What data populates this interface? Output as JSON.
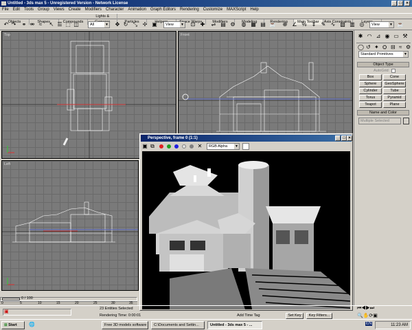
{
  "app": {
    "title": "Untitled - 3ds max 5 - Unregistered Version - Network License"
  },
  "menu": [
    "File",
    "Edit",
    "Tools",
    "Group",
    "Views",
    "Create",
    "Modifiers",
    "Character",
    "Animation",
    "Graph Editors",
    "Rendering",
    "Customize",
    "MAXScript",
    "Help"
  ],
  "tabs": [
    "Objects",
    "Shapes",
    "Compounds",
    "Lights & Cameras",
    "Particles",
    "Helpers",
    "Space Warps",
    "Modifiers",
    "Modeling",
    "Rendering",
    "Main Toolbar",
    "Axis Constraints",
    "Layers"
  ],
  "active_tab": "Main Toolbar",
  "toolbar": {
    "selection_filter": "All",
    "ref_coord": "View",
    "ref_coord2": "View"
  },
  "viewports": {
    "top": "Top",
    "front": "Front",
    "left": "Left",
    "perspective": "Perspective"
  },
  "command_panel": {
    "category": "Standard Primitives",
    "object_type_header": "Object Type",
    "autogrid": "AutoGrid",
    "buttons": [
      "Box",
      "Cone",
      "Sphere",
      "GeoSphere",
      "Cylinder",
      "Tube",
      "Torus",
      "Pyramid",
      "Teapot",
      "Plane"
    ],
    "name_color_header": "Name and Color",
    "name_value": "Multiple Selected"
  },
  "render_window": {
    "title": "Perspective, frame 0 (1:1)",
    "channel": "RGB Alpha"
  },
  "timeline": {
    "frame": "0 / 100",
    "ticks": [
      "0",
      "5",
      "10",
      "15",
      "20",
      "25",
      "30",
      "35"
    ]
  },
  "status": {
    "selected": "23 Entities Selected",
    "render_time": "Rendering Time: 0:00:01",
    "add_time_tag": "Add Time Tag",
    "set_key": "Set Key",
    "key_filters": "Key Filters..."
  },
  "taskbar": {
    "start": "Start",
    "items": [
      "Free 3D models software ...",
      "C:\\Documents and Settin...",
      "Untitled - 3ds max 5 - ..."
    ],
    "lang": "EN",
    "clock": "11:23 AM"
  },
  "colors": {
    "titlebar": "#0a246a",
    "viewport_bg": "#7a7a7a",
    "panel_bg": "#d4d0c8",
    "selected_text": "#ff0000"
  }
}
